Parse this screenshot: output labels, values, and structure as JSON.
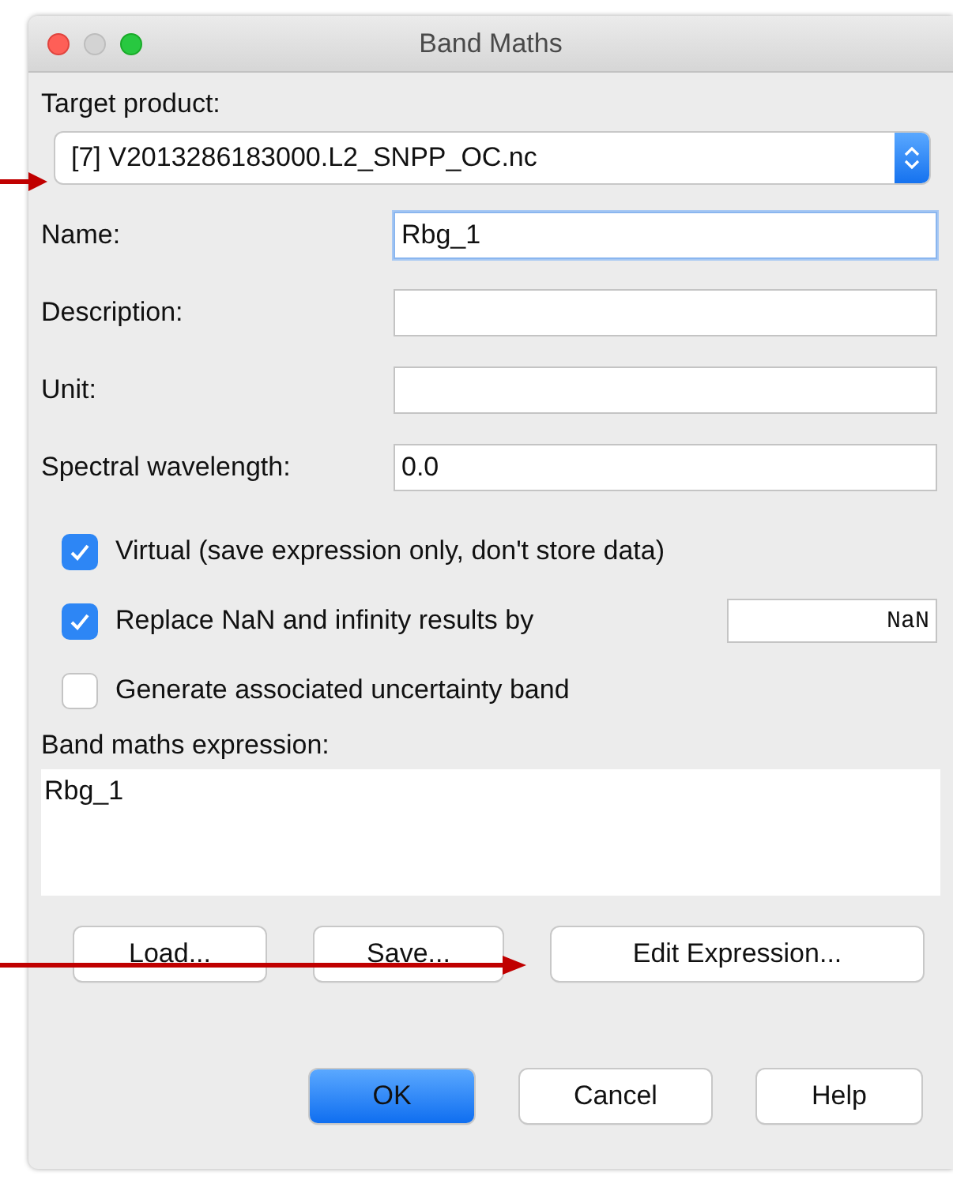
{
  "window": {
    "title": "Band Maths"
  },
  "target_product": {
    "label": "Target product:",
    "value": "[7] V2013286183000.L2_SNPP_OC.nc"
  },
  "fields": [
    {
      "label": "Name:",
      "value": "Rbg_1",
      "focused": true
    },
    {
      "label": "Description:",
      "focused": false
    },
    {
      "label": "Unit:",
      "focused": false
    },
    {
      "label": "Spectral wavelength:",
      "value": "0.0",
      "focused": false
    }
  ],
  "options": [
    {
      "label": "Virtual (save expression only, don't store data)",
      "checked": true
    },
    {
      "label": "Replace NaN and infinity results by",
      "checked": true,
      "value": "NaN"
    },
    {
      "label": "Generate associated uncertainty band",
      "checked": false
    }
  ],
  "expression": {
    "label": "Band maths expression:",
    "value": "Rbg_1"
  },
  "expression_buttons": [
    "Load...",
    "Save...",
    "Edit Expression..."
  ],
  "dialog_buttons": [
    {
      "label": "OK",
      "default": true
    },
    {
      "label": "Cancel",
      "default": false
    },
    {
      "label": "Help",
      "default": false
    }
  ]
}
